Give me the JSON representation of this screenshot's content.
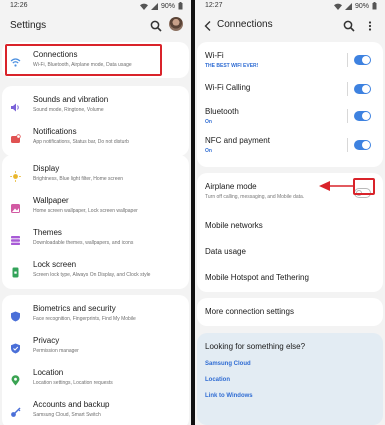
{
  "left": {
    "status": {
      "time": "12:26",
      "battery": "90%"
    },
    "title": "Settings",
    "groups": [
      [
        {
          "title": "Connections",
          "subtitle": "Wi-Fi, Bluetooth, Airplane mode, Data usage",
          "icon": "wifi-icon",
          "color": "#4a8fe0"
        }
      ],
      [
        {
          "title": "Sounds and vibration",
          "subtitle": "Sound mode, Ringtone, Volume",
          "icon": "volume-icon",
          "color": "#7a62d8"
        },
        {
          "title": "Notifications",
          "subtitle": "App notifications, Status bar, Do not disturb",
          "icon": "notification-icon",
          "color": "#e05252"
        }
      ],
      [
        {
          "title": "Display",
          "subtitle": "Brightness, Blue light filter, Home screen",
          "icon": "sun-icon",
          "color": "#e8b52a"
        },
        {
          "title": "Wallpaper",
          "subtitle": "Home screen wallpaper, Lock screen wallpaper",
          "icon": "wallpaper-icon",
          "color": "#d25aa3"
        },
        {
          "title": "Themes",
          "subtitle": "Downloadable themes, wallpapers, and icons",
          "icon": "themes-icon",
          "color": "#a85bd6"
        },
        {
          "title": "Lock screen",
          "subtitle": "Screen lock type, Always On Display, and Clock style",
          "icon": "lock-screen-icon",
          "color": "#33a35a"
        }
      ],
      [
        {
          "title": "Biometrics and security",
          "subtitle": "Face recognition, Fingerprints, Find My Mobile",
          "icon": "shield-icon",
          "color": "#4a6fd8"
        },
        {
          "title": "Privacy",
          "subtitle": "Permission manager",
          "icon": "privacy-icon",
          "color": "#4a6fd8"
        },
        {
          "title": "Location",
          "subtitle": "Location settings, Location requests",
          "icon": "location-icon",
          "color": "#3aa352"
        },
        {
          "title": "Accounts and backup",
          "subtitle": "Samsung Cloud, Smart Switch",
          "icon": "key-icon",
          "color": "#4a6fd8"
        }
      ]
    ]
  },
  "right": {
    "status": {
      "time": "12:27",
      "battery": "90%"
    },
    "title": "Connections",
    "toggles": [
      {
        "title": "Wi-Fi",
        "subtitle": "THE BEST WIFI EVER!",
        "on": true
      },
      {
        "title": "Wi-Fi Calling",
        "subtitle": "",
        "on": true
      },
      {
        "title": "Bluetooth",
        "subtitle": "On",
        "on": true
      },
      {
        "title": "NFC and payment",
        "subtitle": "On",
        "on": true
      }
    ],
    "airplane": {
      "title": "Airplane mode",
      "subtitle": "Turn off calling, messaging, and Mobile data.",
      "on": false
    },
    "plain": [
      "Mobile networks",
      "Data usage",
      "Mobile Hotspot and Tethering"
    ],
    "more": "More connection settings",
    "looking": {
      "question": "Looking for something else?",
      "links": [
        "Samsung Cloud",
        "Location",
        "Link to Windows"
      ]
    },
    "colors": {
      "accent": "#3e82e0",
      "link": "#2f6cd3",
      "annotation": "#d9232a"
    }
  }
}
